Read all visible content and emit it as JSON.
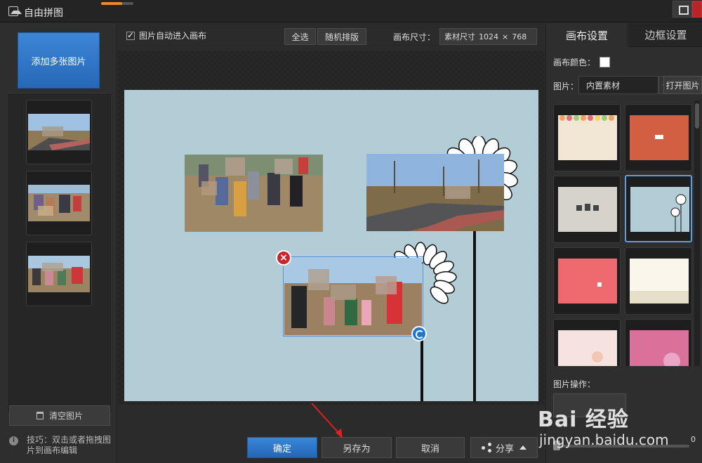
{
  "window": {
    "title": "自由拼图",
    "progress": 0.65
  },
  "left": {
    "add_button": "添加多张图片",
    "clear_button": "清空图片",
    "tip": "技巧：双击或者拖拽图片到画布编辑",
    "thumbnails": 3
  },
  "toolbar": {
    "auto_enter_label": "图片自动进入画布",
    "auto_enter_checked": true,
    "select_all": "全选",
    "random_layout": "随机排版",
    "canvas_size_label": "画布尺寸：",
    "canvas_size_value": "素材尺寸",
    "canvas_width": "1024",
    "canvas_height": "768",
    "times": "×"
  },
  "canvas": {
    "background": "#b2cdd6"
  },
  "bottom": {
    "confirm": "确定",
    "save_as": "另存为",
    "cancel": "取消",
    "share": "分享"
  },
  "right": {
    "tabs": [
      "画布设置",
      "边框设置"
    ],
    "canvas_color_label": "画布颜色：",
    "canvas_color": "#ffffff",
    "picture_label": "图片：",
    "picture_source": "内置素材",
    "open_picture": "打开图片",
    "operations_label": "图片操作：",
    "slider_value": "0",
    "templates": [
      {
        "name": "dots-pennant",
        "selected": false
      },
      {
        "name": "orange-card",
        "selected": false
      },
      {
        "name": "grey-sketch",
        "selected": false
      },
      {
        "name": "blue-flowers",
        "selected": true
      },
      {
        "name": "red-bird",
        "selected": false
      },
      {
        "name": "cream-houses",
        "selected": false
      },
      {
        "name": "pink-tree",
        "selected": false
      },
      {
        "name": "magenta-flowers",
        "selected": false
      }
    ]
  },
  "watermark": {
    "brand": "Bai 经验",
    "url": "jingyan.baidu.com"
  },
  "colors": {
    "accent": "#2d75c8",
    "delete": "#c9252b",
    "arrow": "#e02020"
  }
}
